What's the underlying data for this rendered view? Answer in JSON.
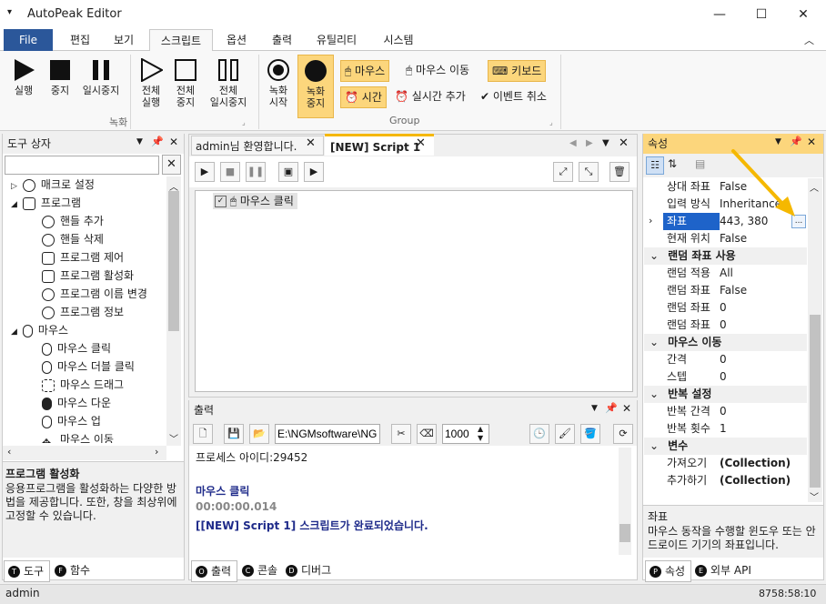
{
  "window": {
    "title": "AutoPeak Editor",
    "menu_glyph": "▾",
    "min": "—",
    "max": "☐",
    "close": "✕"
  },
  "ribbon_tabs": [
    "File",
    "편집",
    "보기",
    "스크립트",
    "옵션",
    "출력",
    "유틸리티",
    "시스템"
  ],
  "ribbon_collapse": "︿",
  "record_group": {
    "label": "녹화",
    "run": "실행",
    "stop": "중지",
    "pause": "일시중지",
    "run_all": [
      "전체",
      "실행"
    ],
    "stop_all": [
      "전체",
      "중지"
    ],
    "pause_all": [
      "전체",
      "일시중지"
    ]
  },
  "group_group": {
    "label": "Group",
    "rec_start": [
      "녹화",
      "시작"
    ],
    "rec_stop": [
      "녹화",
      "중지"
    ],
    "mouse": "마우스",
    "mouse_move": "마우스 이동",
    "keyboard": "키보드",
    "time": "시간",
    "realtime_add": "실시간 추가",
    "event_cancel": "이벤트 취소"
  },
  "toolbox": {
    "title": "도구 상자",
    "search_value": "",
    "items": [
      "매크로 설정",
      "프로그램",
      "핸들 추가",
      "핸들 삭제",
      "프로그램 제어",
      "프로그램 활성화",
      "프로그램 이름 변경",
      "프로그램 정보",
      "마우스",
      "마우스 클릭",
      "마우스 더블 클릭",
      "마우스 드래그",
      "마우스 다운",
      "마우스 업",
      "마우스 이동"
    ],
    "desc_title": "프로그램 활성화",
    "desc_text": "응용프로그램을 활성화하는 다양한 방법을 제공합니다. 또한, 창을 최상위에 고정할 수 있습니다.",
    "tabs": [
      "도구",
      "함수"
    ]
  },
  "doc_tabs": [
    "admin님 환영합니다.",
    "[NEW] Script 1"
  ],
  "script_items": [
    "마우스 클릭"
  ],
  "output": {
    "title": "출력",
    "path": "E:\\NGMsoftware\\NG",
    "speed": "1000",
    "lines": [
      "프로세스 아이디:29452",
      "",
      "마우스 클릭",
      "00:00:00.014",
      "[[NEW] Script 1] 스크립트가 완료되었습니다."
    ],
    "tabs": [
      "출력",
      "콘솔",
      "디버그"
    ]
  },
  "properties": {
    "title": "속성",
    "rows": [
      {
        "name": "상대 좌표",
        "value": "False"
      },
      {
        "name": "입력 방식",
        "value": "Inheritance"
      },
      {
        "name": "좌표",
        "value": "443, 380"
      },
      {
        "name": "현재 위치",
        "value": "False"
      }
    ],
    "cat_random": "랜덤 좌표 사용",
    "random_rows": [
      {
        "name": "랜덤 적용",
        "value": "All"
      },
      {
        "name": "랜덤 좌표",
        "value": "False"
      },
      {
        "name": "랜덤 좌표",
        "value": "0"
      },
      {
        "name": "랜덤 좌표",
        "value": "0"
      }
    ],
    "cat_move": "마우스 이동",
    "move_rows": [
      {
        "name": "간격",
        "value": "0"
      },
      {
        "name": "스텝",
        "value": "0"
      }
    ],
    "cat_repeat": "반복 설정",
    "repeat_rows": [
      {
        "name": "반복 간격",
        "value": "0"
      },
      {
        "name": "반복 횟수",
        "value": "1"
      }
    ],
    "cat_var": "변수",
    "var_rows": [
      {
        "name": "가져오기",
        "value": "(Collection)"
      },
      {
        "name": "추가하기",
        "value": "(Collection)"
      }
    ],
    "desc_title": "좌표",
    "desc_text": "마우스 동작을 수행할 윈도우 또는 안드로이드 기기의 좌표입니다.",
    "tabs": [
      "속성",
      "외부 API"
    ],
    "ellipsis": "..."
  },
  "status": {
    "user": "admin",
    "clock": "8758:58:10"
  },
  "colors": {
    "accent": "#2b579a",
    "highlight": "#fcd67c",
    "panel_active": "#fcd67c",
    "link_blue": "#1f2b8a",
    "arrow": "#f5b800"
  }
}
